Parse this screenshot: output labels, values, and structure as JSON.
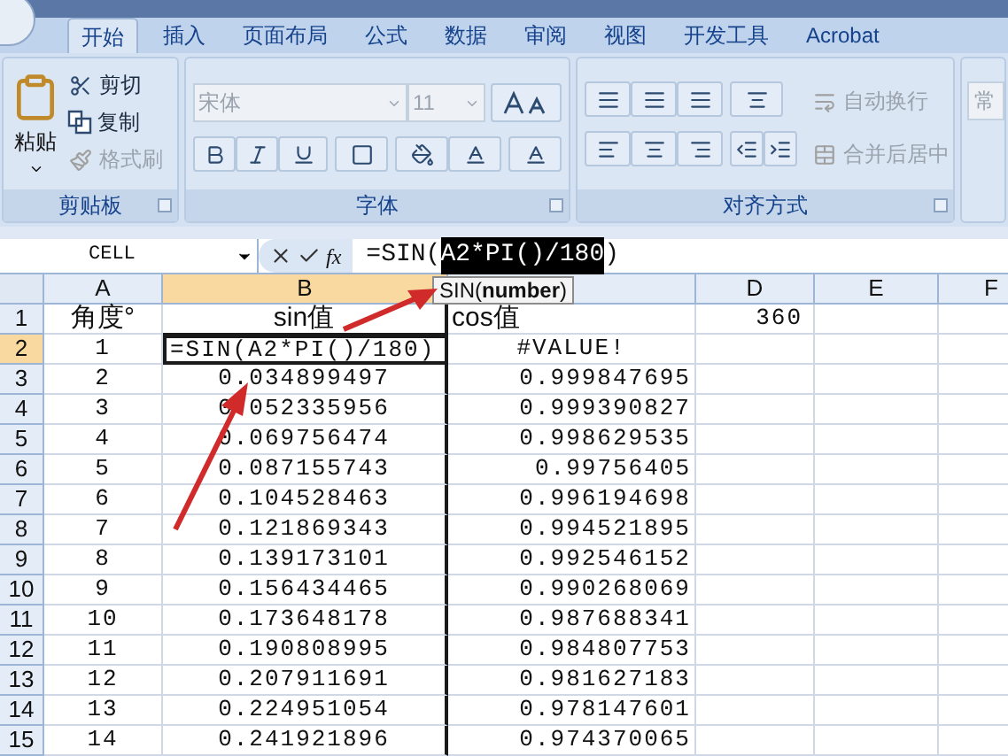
{
  "tabs": [
    {
      "label": "开始",
      "selected": true
    },
    {
      "label": "插入",
      "selected": false
    },
    {
      "label": "页面布局",
      "selected": false
    },
    {
      "label": "公式",
      "selected": false
    },
    {
      "label": "数据",
      "selected": false
    },
    {
      "label": "审阅",
      "selected": false
    },
    {
      "label": "视图",
      "selected": false
    },
    {
      "label": "开发工具",
      "selected": false
    },
    {
      "label": "Acrobat",
      "selected": false
    }
  ],
  "ribbon": {
    "groups": [
      {
        "kind": "clipboard",
        "label": "剪贴板",
        "paste": "粘贴",
        "items": [
          {
            "label": "剪切",
            "disabled": false
          },
          {
            "label": "复制",
            "disabled": false
          },
          {
            "label": "格式刷",
            "disabled": true
          }
        ]
      },
      {
        "kind": "font",
        "label": "字体",
        "font_name": "宋体",
        "font_size": "11"
      },
      {
        "kind": "alignment",
        "label": "对齐方式",
        "items": [
          {
            "label": "自动换行",
            "disabled": true
          },
          {
            "label": "合并后居中",
            "disabled": true
          }
        ]
      },
      {
        "kind": "number",
        "format": "常"
      }
    ]
  },
  "formula_bar": {
    "name_box": "CELL",
    "function_label": "fx",
    "formula_before": "=SIN(",
    "formula_selected": "A2*PI()/180",
    "formula_after": ")"
  },
  "tooltip": "SIN(**number**)",
  "sheet": {
    "columns": [
      {
        "label": "A",
        "selected": false
      },
      {
        "label": "B",
        "selected": true
      },
      {
        "selected": false
      },
      {
        "label": "D",
        "selected": false
      },
      {
        "label": "E",
        "selected": false
      },
      {
        "label": "F",
        "selected": false
      }
    ],
    "rows": [
      {
        "label": "1",
        "selected": false,
        "kind": "header",
        "cells": {
          "a": "角度°",
          "b": "sin值",
          "c": "cos值",
          "d": "360"
        }
      },
      {
        "label": "2",
        "selected": true,
        "kind": "editing",
        "cells": {
          "a": "1",
          "b": "=SIN(A2*PI()/180)",
          "c": "#VALUE!"
        }
      },
      {
        "label": "3",
        "selected": false,
        "kind": "value",
        "cells": {
          "a": "2",
          "b": "0.034899497",
          "c": "0.999847695"
        }
      },
      {
        "label": "4",
        "selected": false,
        "kind": "value",
        "cells": {
          "a": "3",
          "b": "0.052335956",
          "c": "0.999390827"
        }
      },
      {
        "label": "5",
        "selected": false,
        "kind": "value",
        "cells": {
          "a": "4",
          "b": "0.069756474",
          "c": "0.998629535"
        }
      },
      {
        "label": "6",
        "selected": false,
        "kind": "value",
        "cells": {
          "a": "5",
          "b": "0.087155743",
          "c": "0.99756405"
        }
      },
      {
        "label": "7",
        "selected": false,
        "kind": "value",
        "cells": {
          "a": "6",
          "b": "0.104528463",
          "c": "0.996194698"
        }
      },
      {
        "label": "8",
        "selected": false,
        "kind": "value",
        "cells": {
          "a": "7",
          "b": "0.121869343",
          "c": "0.994521895"
        }
      },
      {
        "label": "9",
        "selected": false,
        "kind": "value",
        "cells": {
          "a": "8",
          "b": "0.139173101",
          "c": "0.992546152"
        }
      },
      {
        "label": "10",
        "selected": false,
        "kind": "value",
        "cells": {
          "a": "9",
          "b": "0.156434465",
          "c": "0.990268069"
        }
      },
      {
        "label": "11",
        "selected": false,
        "kind": "value",
        "cells": {
          "a": "10",
          "b": "0.173648178",
          "c": "0.987688341"
        }
      },
      {
        "label": "12",
        "selected": false,
        "kind": "value",
        "cells": {
          "a": "11",
          "b": "0.190808995",
          "c": "0.984807753"
        }
      },
      {
        "label": "13",
        "selected": false,
        "kind": "value",
        "cells": {
          "a": "12",
          "b": "0.207911691",
          "c": "0.981627183"
        }
      },
      {
        "label": "14",
        "selected": false,
        "kind": "value",
        "cells": {
          "a": "13",
          "b": "0.224951054",
          "c": "0.978147601"
        }
      },
      {
        "label": "15",
        "selected": false,
        "kind": "value",
        "cells": {
          "a": "14",
          "b": "0.241921896",
          "c": "0.974370065"
        }
      }
    ]
  }
}
